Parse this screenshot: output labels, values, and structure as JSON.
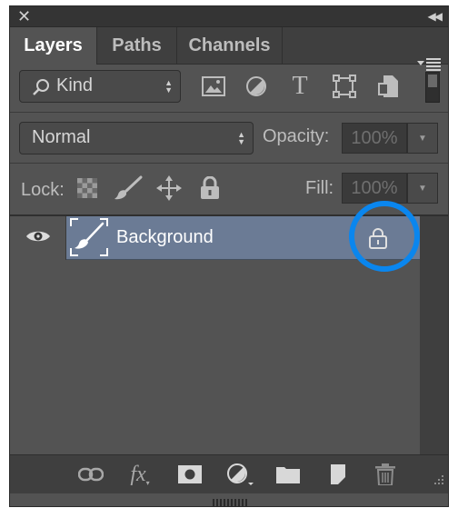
{
  "titlebar": {
    "close_icon": "close-icon",
    "collapse_icon": "collapse-panel-icon"
  },
  "tabs": [
    {
      "label": "Layers",
      "active": true
    },
    {
      "label": "Paths",
      "active": false
    },
    {
      "label": "Channels",
      "active": false
    }
  ],
  "panel_menu_icon": "panel-menu-icon",
  "filter": {
    "kind_label": "Kind",
    "icons": [
      "image-filter-icon",
      "adjustment-filter-icon",
      "type-filter-icon",
      "shape-filter-icon",
      "smart-object-filter-icon"
    ]
  },
  "blend": {
    "mode": "Normal",
    "opacity_label": "Opacity:",
    "opacity_value": "100%"
  },
  "lock": {
    "label": "Lock:",
    "icons": [
      "lock-transparent-pixels-icon",
      "lock-image-pixels-icon",
      "lock-position-icon",
      "lock-all-icon"
    ],
    "fill_label": "Fill:",
    "fill_value": "100%"
  },
  "layers": [
    {
      "name": "Background",
      "visible": true,
      "locked": true,
      "selected": true
    }
  ],
  "footer_icons": [
    "link-layers-icon",
    "fx-icon",
    "add-mask-icon",
    "adjustment-layer-icon",
    "new-group-icon",
    "new-layer-icon",
    "delete-layer-icon"
  ],
  "colors": {
    "selection": "#6b7b95",
    "highlight_ring": "#0a86ee",
    "panel_bg": "#535353"
  }
}
